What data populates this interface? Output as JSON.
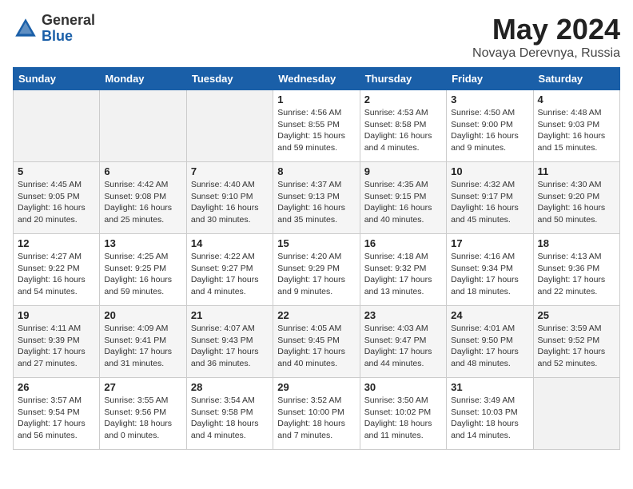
{
  "header": {
    "logo_general": "General",
    "logo_blue": "Blue",
    "month_year": "May 2024",
    "location": "Novaya Derevnya, Russia"
  },
  "weekdays": [
    "Sunday",
    "Monday",
    "Tuesday",
    "Wednesday",
    "Thursday",
    "Friday",
    "Saturday"
  ],
  "weeks": [
    [
      {
        "day": "",
        "info": ""
      },
      {
        "day": "",
        "info": ""
      },
      {
        "day": "",
        "info": ""
      },
      {
        "day": "1",
        "info": "Sunrise: 4:56 AM\nSunset: 8:55 PM\nDaylight: 15 hours\nand 59 minutes."
      },
      {
        "day": "2",
        "info": "Sunrise: 4:53 AM\nSunset: 8:58 PM\nDaylight: 16 hours\nand 4 minutes."
      },
      {
        "day": "3",
        "info": "Sunrise: 4:50 AM\nSunset: 9:00 PM\nDaylight: 16 hours\nand 9 minutes."
      },
      {
        "day": "4",
        "info": "Sunrise: 4:48 AM\nSunset: 9:03 PM\nDaylight: 16 hours\nand 15 minutes."
      }
    ],
    [
      {
        "day": "5",
        "info": "Sunrise: 4:45 AM\nSunset: 9:05 PM\nDaylight: 16 hours\nand 20 minutes."
      },
      {
        "day": "6",
        "info": "Sunrise: 4:42 AM\nSunset: 9:08 PM\nDaylight: 16 hours\nand 25 minutes."
      },
      {
        "day": "7",
        "info": "Sunrise: 4:40 AM\nSunset: 9:10 PM\nDaylight: 16 hours\nand 30 minutes."
      },
      {
        "day": "8",
        "info": "Sunrise: 4:37 AM\nSunset: 9:13 PM\nDaylight: 16 hours\nand 35 minutes."
      },
      {
        "day": "9",
        "info": "Sunrise: 4:35 AM\nSunset: 9:15 PM\nDaylight: 16 hours\nand 40 minutes."
      },
      {
        "day": "10",
        "info": "Sunrise: 4:32 AM\nSunset: 9:17 PM\nDaylight: 16 hours\nand 45 minutes."
      },
      {
        "day": "11",
        "info": "Sunrise: 4:30 AM\nSunset: 9:20 PM\nDaylight: 16 hours\nand 50 minutes."
      }
    ],
    [
      {
        "day": "12",
        "info": "Sunrise: 4:27 AM\nSunset: 9:22 PM\nDaylight: 16 hours\nand 54 minutes."
      },
      {
        "day": "13",
        "info": "Sunrise: 4:25 AM\nSunset: 9:25 PM\nDaylight: 16 hours\nand 59 minutes."
      },
      {
        "day": "14",
        "info": "Sunrise: 4:22 AM\nSunset: 9:27 PM\nDaylight: 17 hours\nand 4 minutes."
      },
      {
        "day": "15",
        "info": "Sunrise: 4:20 AM\nSunset: 9:29 PM\nDaylight: 17 hours\nand 9 minutes."
      },
      {
        "day": "16",
        "info": "Sunrise: 4:18 AM\nSunset: 9:32 PM\nDaylight: 17 hours\nand 13 minutes."
      },
      {
        "day": "17",
        "info": "Sunrise: 4:16 AM\nSunset: 9:34 PM\nDaylight: 17 hours\nand 18 minutes."
      },
      {
        "day": "18",
        "info": "Sunrise: 4:13 AM\nSunset: 9:36 PM\nDaylight: 17 hours\nand 22 minutes."
      }
    ],
    [
      {
        "day": "19",
        "info": "Sunrise: 4:11 AM\nSunset: 9:39 PM\nDaylight: 17 hours\nand 27 minutes."
      },
      {
        "day": "20",
        "info": "Sunrise: 4:09 AM\nSunset: 9:41 PM\nDaylight: 17 hours\nand 31 minutes."
      },
      {
        "day": "21",
        "info": "Sunrise: 4:07 AM\nSunset: 9:43 PM\nDaylight: 17 hours\nand 36 minutes."
      },
      {
        "day": "22",
        "info": "Sunrise: 4:05 AM\nSunset: 9:45 PM\nDaylight: 17 hours\nand 40 minutes."
      },
      {
        "day": "23",
        "info": "Sunrise: 4:03 AM\nSunset: 9:47 PM\nDaylight: 17 hours\nand 44 minutes."
      },
      {
        "day": "24",
        "info": "Sunrise: 4:01 AM\nSunset: 9:50 PM\nDaylight: 17 hours\nand 48 minutes."
      },
      {
        "day": "25",
        "info": "Sunrise: 3:59 AM\nSunset: 9:52 PM\nDaylight: 17 hours\nand 52 minutes."
      }
    ],
    [
      {
        "day": "26",
        "info": "Sunrise: 3:57 AM\nSunset: 9:54 PM\nDaylight: 17 hours\nand 56 minutes."
      },
      {
        "day": "27",
        "info": "Sunrise: 3:55 AM\nSunset: 9:56 PM\nDaylight: 18 hours\nand 0 minutes."
      },
      {
        "day": "28",
        "info": "Sunrise: 3:54 AM\nSunset: 9:58 PM\nDaylight: 18 hours\nand 4 minutes."
      },
      {
        "day": "29",
        "info": "Sunrise: 3:52 AM\nSunset: 10:00 PM\nDaylight: 18 hours\nand 7 minutes."
      },
      {
        "day": "30",
        "info": "Sunrise: 3:50 AM\nSunset: 10:02 PM\nDaylight: 18 hours\nand 11 minutes."
      },
      {
        "day": "31",
        "info": "Sunrise: 3:49 AM\nSunset: 10:03 PM\nDaylight: 18 hours\nand 14 minutes."
      },
      {
        "day": "",
        "info": ""
      }
    ]
  ]
}
